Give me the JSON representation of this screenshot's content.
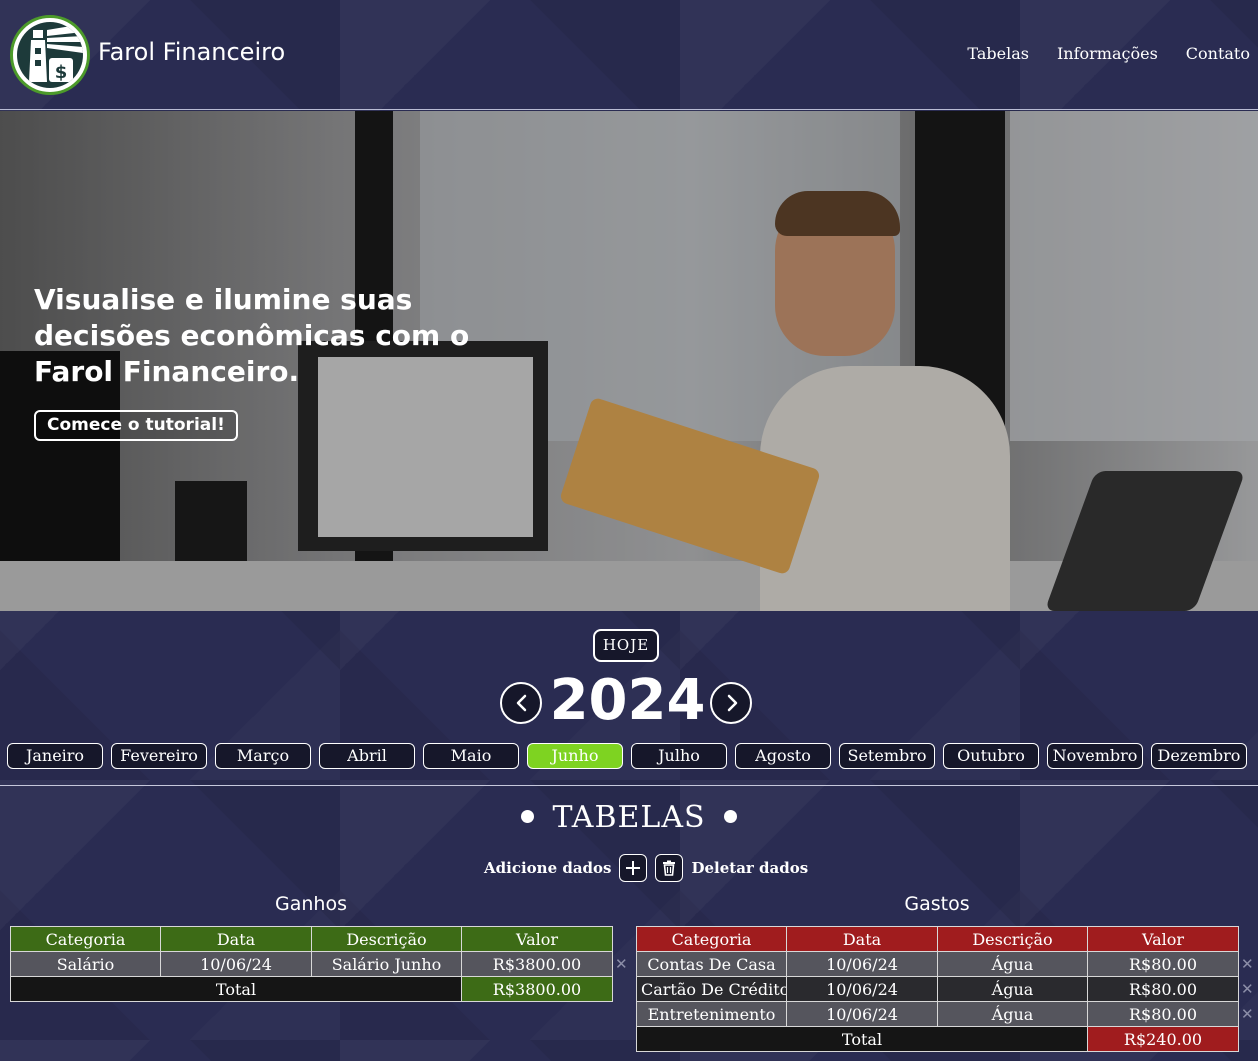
{
  "brand": {
    "name": "Farol Financeiro",
    "logo_icon": "lighthouse-dollar-icon"
  },
  "nav": [
    {
      "label": "Tabelas"
    },
    {
      "label": "Informações"
    },
    {
      "label": "Contato"
    }
  ],
  "hero": {
    "headline": "Visualise e ilumine suas decisões econômicas com o Farol Financeiro.",
    "cta_label": "Comece o tutorial!"
  },
  "calendar": {
    "today_label": "HOJE",
    "year": "2024",
    "months": [
      "Janeiro",
      "Fevereiro",
      "Março",
      "Abril",
      "Maio",
      "Junho",
      "Julho",
      "Agosto",
      "Setembro",
      "Outubro",
      "Novembro",
      "Dezembro"
    ],
    "selected_month": "Junho"
  },
  "tables_section": {
    "title": "TABELAS",
    "add_label": "Adicione dados",
    "delete_label": "Deletar dados"
  },
  "ganhos": {
    "title": "Ganhos",
    "headers": [
      "Categoria",
      "Data",
      "Descrição",
      "Valor"
    ],
    "rows": [
      [
        "Salário",
        "10/06/24",
        "Salário Junho",
        "R$3800.00"
      ]
    ],
    "total_label": "Total",
    "total_value": "R$3800.00",
    "color": "#3d6b16"
  },
  "gastos": {
    "title": "Gastos",
    "headers": [
      "Categoria",
      "Data",
      "Descrição",
      "Valor"
    ],
    "rows": [
      [
        "Contas De Casa",
        "10/06/24",
        "Água",
        "R$80.00"
      ],
      [
        "Cartão De Crédito",
        "10/06/24",
        "Água",
        "R$80.00"
      ],
      [
        "Entretenimento",
        "10/06/24",
        "Água",
        "R$80.00"
      ]
    ],
    "total_label": "Total",
    "total_value": "R$240.00",
    "color": "#a01c1e"
  },
  "colors": {
    "accent_month": "#7ed321",
    "background": "#2a2c52"
  }
}
